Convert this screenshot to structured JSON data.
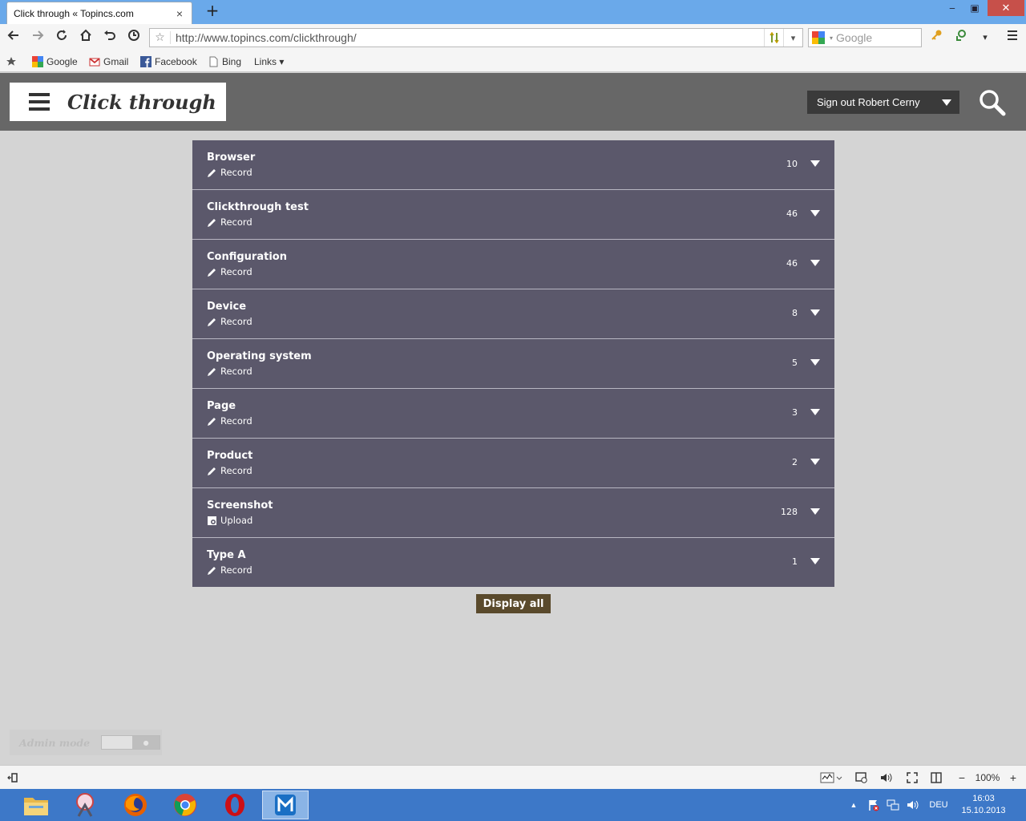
{
  "browser": {
    "tab_title": "Click through « Topincs.com",
    "tab_close": "×",
    "new_tab": "+",
    "window_min": "‒",
    "window_max": "▣",
    "window_close": "✕",
    "url": "http://www.topincs.com/clickthrough/",
    "search_placeholder": "Google",
    "bookmarks": [
      {
        "label": "Google"
      },
      {
        "label": "Gmail"
      },
      {
        "label": "Facebook"
      },
      {
        "label": "Bing"
      },
      {
        "label": "Links ▾"
      }
    ]
  },
  "site": {
    "title": "Click through",
    "signout_label": "Sign out Robert Cerny",
    "display_all_label": "Display all",
    "admin_mode_label": "Admin mode"
  },
  "list": [
    {
      "name": "Browser",
      "action": "Record",
      "action_icon": "pencil-icon",
      "count": "10"
    },
    {
      "name": "Clickthrough test",
      "action": "Record",
      "action_icon": "pencil-icon",
      "count": "46"
    },
    {
      "name": "Configuration",
      "action": "Record",
      "action_icon": "pencil-icon",
      "count": "46"
    },
    {
      "name": "Device",
      "action": "Record",
      "action_icon": "pencil-icon",
      "count": "8"
    },
    {
      "name": "Operating system",
      "action": "Record",
      "action_icon": "pencil-icon",
      "count": "5"
    },
    {
      "name": "Page",
      "action": "Record",
      "action_icon": "pencil-icon",
      "count": "3"
    },
    {
      "name": "Product",
      "action": "Record",
      "action_icon": "pencil-icon",
      "count": "2"
    },
    {
      "name": "Screenshot",
      "action": "Upload",
      "action_icon": "upload-icon",
      "count": "128"
    },
    {
      "name": "Type A",
      "action": "Record",
      "action_icon": "pencil-icon",
      "count": "1"
    }
  ],
  "statusbar": {
    "zoom": "100%",
    "zoom_minus": "−",
    "zoom_plus": "+"
  },
  "taskbar": {
    "language": "DEU",
    "time": "16:03",
    "date": "15.10.2013"
  },
  "colors": {
    "header_bg": "#676767",
    "row_bg": "#5b586b",
    "page_bg": "#d4d4d4",
    "display_all_bg": "#5a4a2c",
    "taskbar_bg": "#3d78c8"
  }
}
